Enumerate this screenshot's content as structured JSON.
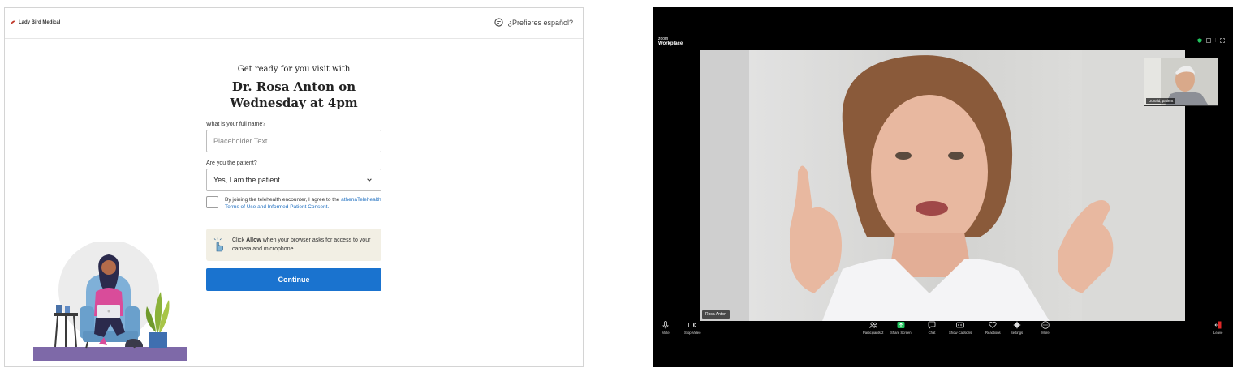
{
  "checkin": {
    "brand_name": "Lady Bird Medical",
    "language_toggle": "¿Prefieres español?",
    "heading_sub": "Get ready for you visit with",
    "heading_line1": "Dr. Rosa Anton on",
    "heading_line2": "Wednesday at 4pm",
    "name_label": "What is your full name?",
    "name_placeholder": "Placeholder Text",
    "patient_label": "Are you the patient?",
    "patient_selected": "Yes, I am the patient",
    "consent_prefix": "By joining the telehealth encounter, I agree to the",
    "consent_link": "athenaTelehealth Terms of Use and Informed Patient Consent.",
    "notice_prefix": "Click",
    "notice_bold": "Allow",
    "notice_suffix": "when your browser asks for access to your camera and microphone.",
    "continue_label": "Continue",
    "colors": {
      "primary": "#1a73cf",
      "notice_bg": "#f2efe4",
      "link": "#1f6fc0"
    }
  },
  "zoom": {
    "logo_small": "zoom",
    "logo_name": "Workplace",
    "speaker_name": "Rosa Anton",
    "thumbnail_name": "Donald, patient",
    "controls": {
      "mute": "Mute",
      "stop_video": "Stop Video",
      "participants": "Participants",
      "participants_count": "2",
      "share_screen": "Share Screen",
      "chat": "Chat",
      "show_captions": "Show Captions",
      "reactions": "Reactions",
      "settings": "Settings",
      "more": "More",
      "leave": "Leave"
    },
    "colors": {
      "background": "#000000",
      "share_green": "#22c55e",
      "leave_red": "#e02828"
    }
  }
}
